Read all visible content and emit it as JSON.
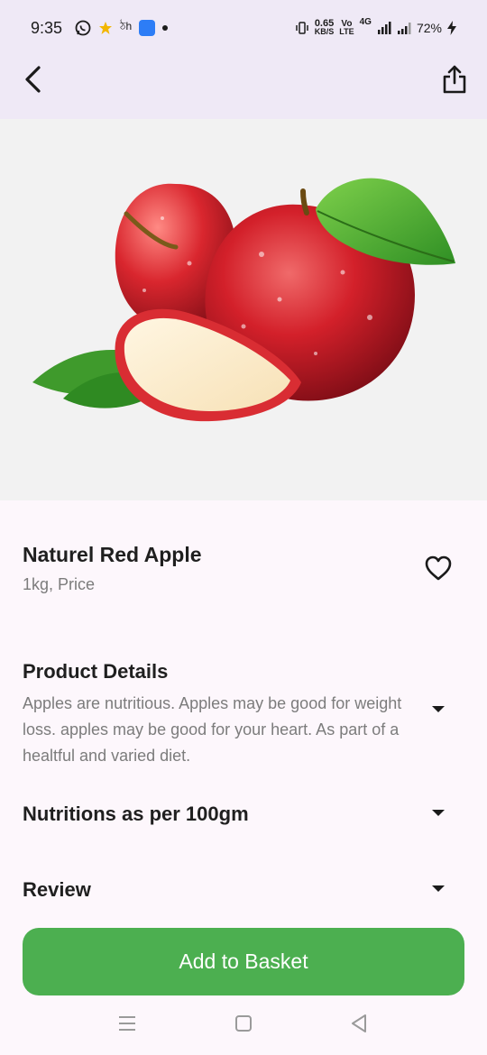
{
  "status_bar": {
    "time": "9:35",
    "network_speed_value": "0.65",
    "network_speed_unit": "KB/S",
    "volte_top": "Vo",
    "volte_bottom": "LTE",
    "network_type": "4G",
    "battery": "72%"
  },
  "app_bar": {
    "back_icon": "chevron-left-icon",
    "share_icon": "share-icon"
  },
  "product": {
    "title": "Naturel Red Apple",
    "subtitle": "1kg, Price",
    "favorite_icon": "heart-outline-icon"
  },
  "sections": {
    "details_title": "Product Details",
    "details_text": "Apples are nutritious. Apples may be good for weight loss. apples may be good for your heart. As part of a healtful and varied diet.",
    "nutrition_title": "Nutritions as per 100gm",
    "review_title": "Review"
  },
  "cta": {
    "label": "Add to Basket",
    "color": "#4caf50"
  },
  "colors": {
    "appbar_bg": "#efe9f6",
    "page_bg": "#fdf7fc",
    "text_secondary": "#7c7c7c"
  }
}
